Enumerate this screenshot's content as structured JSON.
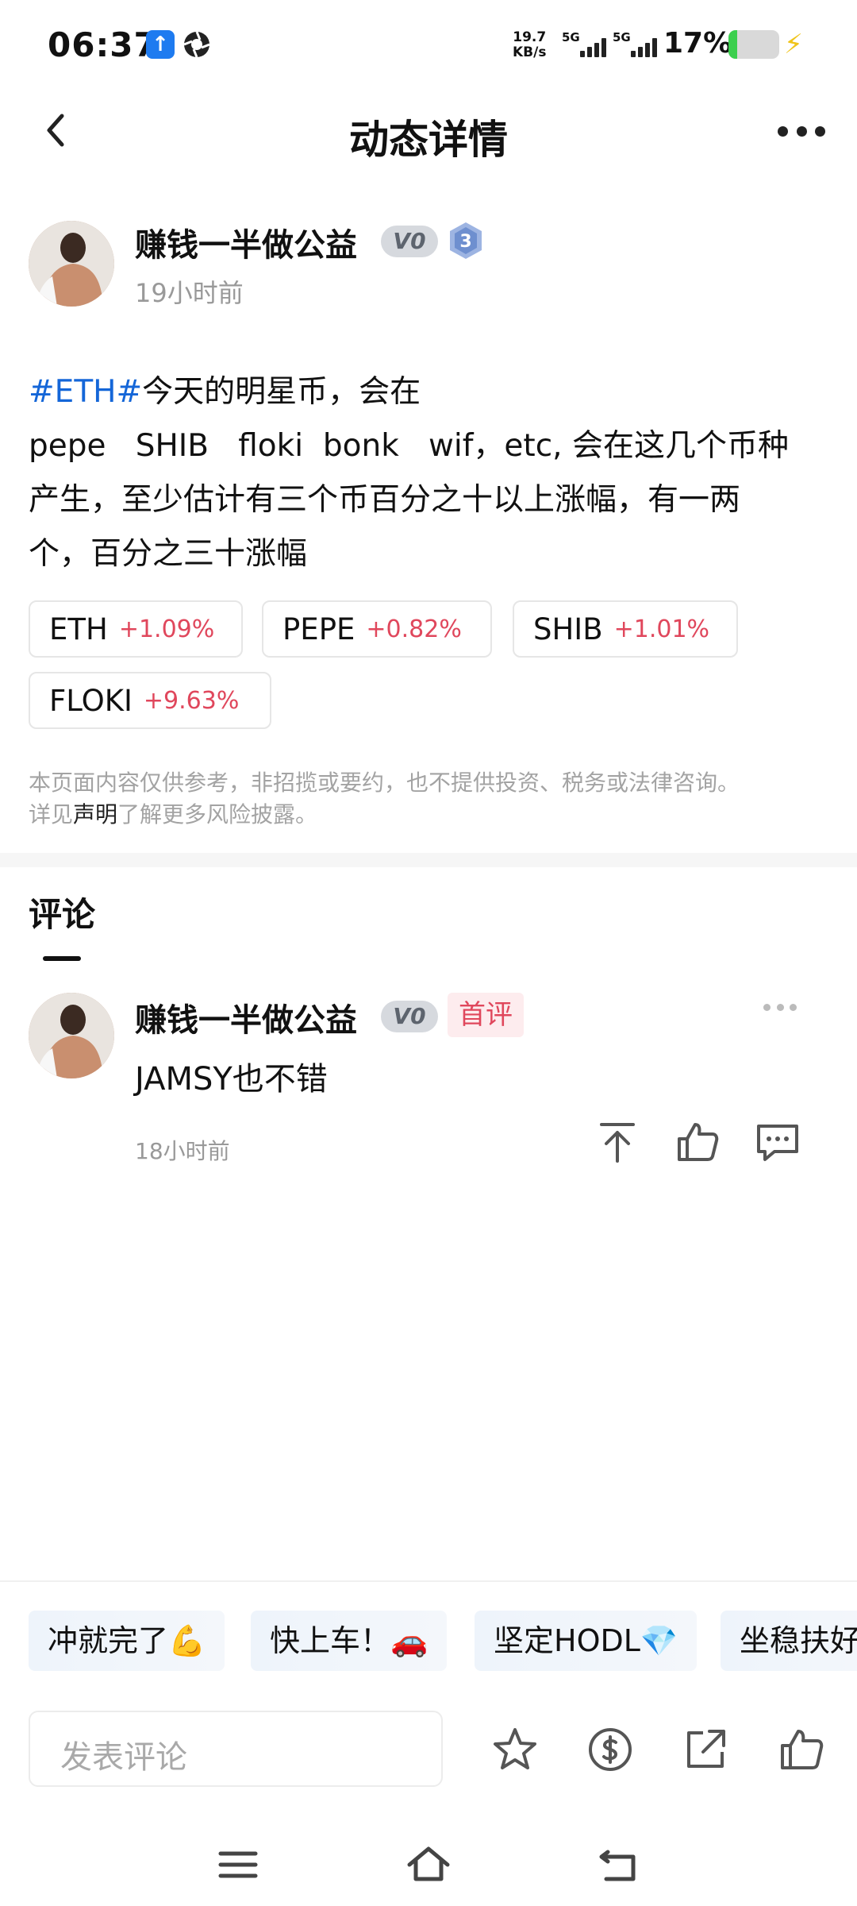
{
  "status_bar": {
    "time": "06:37",
    "speed_value": "19.7",
    "speed_unit": "KB/s",
    "signal_1": "5G",
    "signal_2": "5G",
    "battery_percent": "17%",
    "battery_level": 0.17
  },
  "nav": {
    "title": "动态详情"
  },
  "post": {
    "author_name": "赚钱一半做公益",
    "vip_badge": "V0",
    "level": "3",
    "time": "19小时前",
    "hashtag": "#ETH#",
    "line1": "今天的明星币，会在",
    "line2": "pepe   SHIB   floki  bonk   wif，etc, 会在这几个币种",
    "line3": "产生，至少估计有三个币百分之十以上涨幅，有一两",
    "line4": "个，百分之三十涨幅"
  },
  "coins": [
    {
      "symbol": "ETH",
      "change": "+1.09%"
    },
    {
      "symbol": "PEPE",
      "change": "+0.82%"
    },
    {
      "symbol": "SHIB",
      "change": "+1.01%"
    },
    {
      "symbol": "FLOKI",
      "change": "+9.63%"
    }
  ],
  "disclaimer": {
    "line1": "本页面内容仅供参考，非招揽或要约，也不提供投资、税务或法律咨询。",
    "prefix": "详见",
    "link": "声明",
    "suffix": "了解更多风险披露。"
  },
  "comments": {
    "title": "评论",
    "items": [
      {
        "author": "赚钱一半做公益",
        "vip_badge": "V0",
        "first_badge": "首评",
        "text": "JAMSY也不错",
        "time": "18小时前"
      }
    ]
  },
  "quick_replies": [
    "冲就完了💪",
    "快上车！🚗",
    "坚定HODL💎",
    "坐稳扶好"
  ],
  "bottom_bar": {
    "comment_placeholder": "发表评论"
  },
  "colors": {
    "hashtag": "#1466d8",
    "gain": "#e0475c",
    "muted": "#999999"
  }
}
